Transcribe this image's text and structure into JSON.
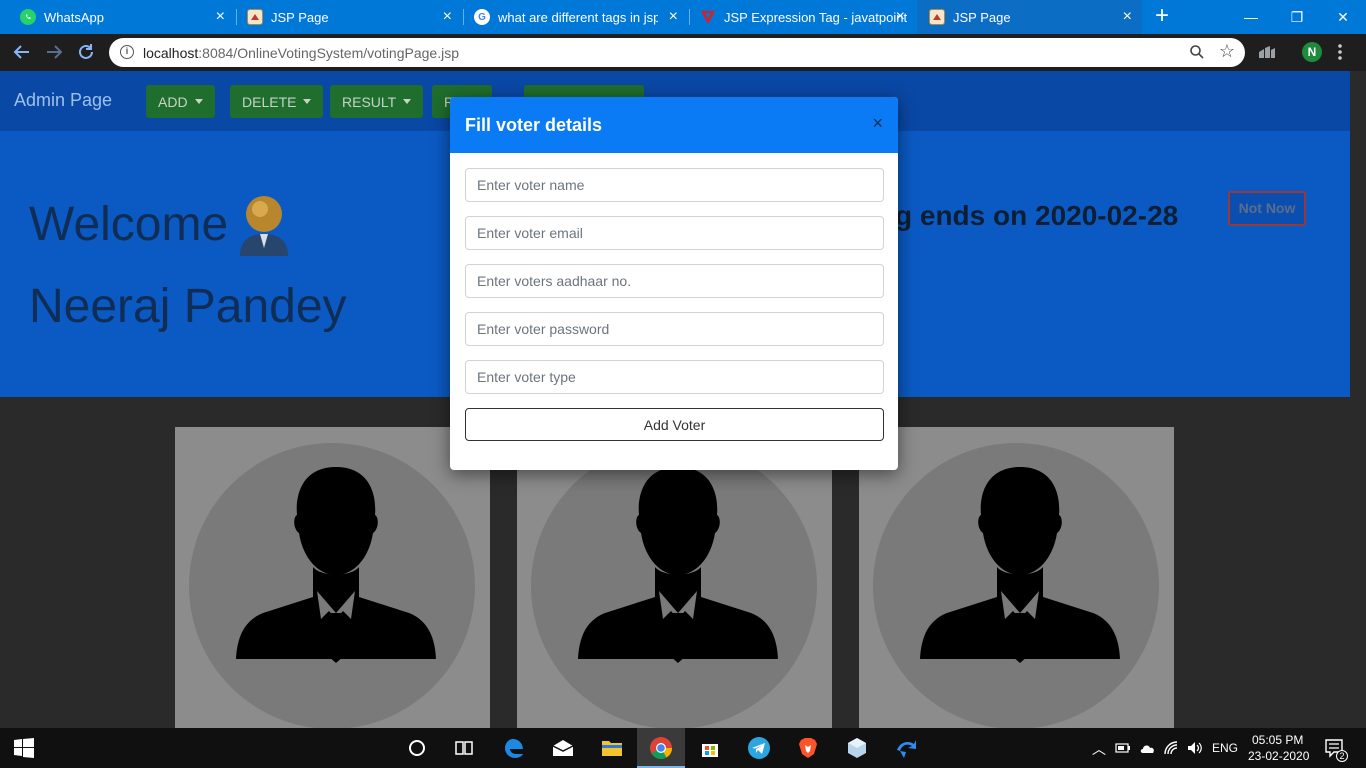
{
  "browser": {
    "tabs": [
      {
        "title": "WhatsApp",
        "icon": "whatsapp-icon",
        "active": false
      },
      {
        "title": "JSP Page",
        "icon": "page-icon",
        "active": false
      },
      {
        "title": "what are different tags in jsp -",
        "icon": "google-icon",
        "active": false
      },
      {
        "title": "JSP Expression Tag - javatpoint",
        "icon": "javatpoint-icon",
        "active": false
      },
      {
        "title": "JSP Page",
        "icon": "page-icon",
        "active": true
      }
    ],
    "new_tab": "+",
    "close_glyph": "×",
    "url_host": "localhost",
    "url_path": ":8084/OnlineVotingSystem/votingPage.jsp",
    "profile_initial": "N",
    "window_controls": {
      "minimize": "—",
      "maximize": "❐",
      "close": "✕"
    }
  },
  "navbar": {
    "brand": "Admin Page",
    "menus": [
      {
        "label": "ADD"
      },
      {
        "label": "DELETE"
      },
      {
        "label": "RESULT"
      },
      {
        "label": "R"
      }
    ]
  },
  "header": {
    "welcome": "Welcome",
    "user_name": "Neeraj Pandey",
    "voting_end": "g ends on 2020-02-28",
    "not_now": "Not Now"
  },
  "modal": {
    "title": "Fill voter details",
    "close_glyph": "×",
    "fields": {
      "name": "Enter voter name",
      "email": "Enter voter email",
      "aadhaar": "Enter voters aadhaar no.",
      "password": "Enter voter password",
      "type": "Enter voter type"
    },
    "submit": "Add Voter"
  },
  "taskbar": {
    "language": "ENG",
    "time": "05:05 PM",
    "date": "23-02-2020",
    "notifications": "2"
  },
  "colors": {
    "accent": "#0a7bf5",
    "header_bg": "#0b5ac4",
    "nav_button": "#1f6e2d"
  }
}
